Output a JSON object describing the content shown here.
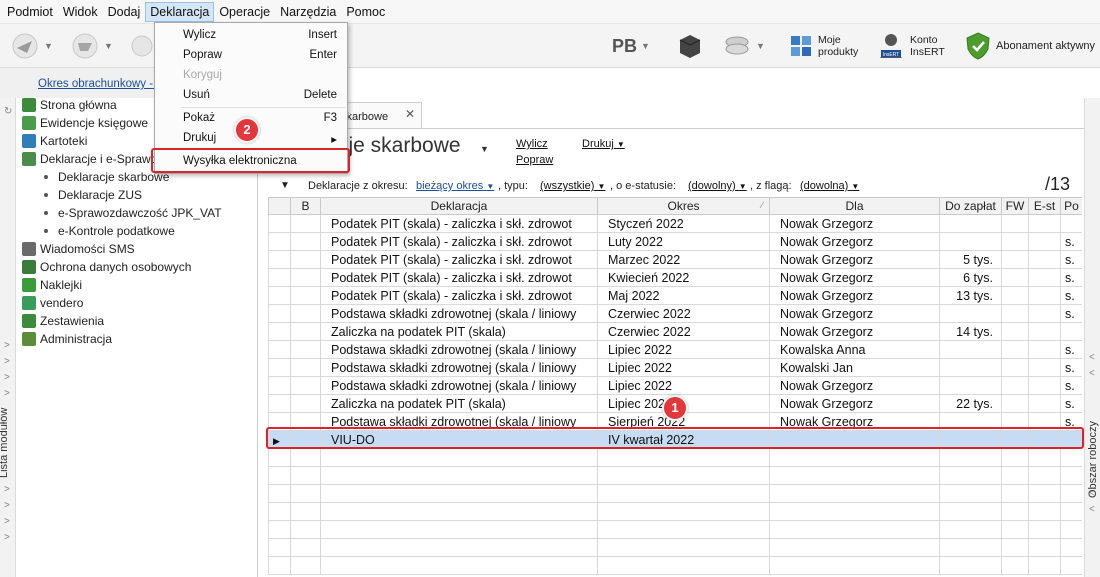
{
  "menu": {
    "items": [
      "Podmiot",
      "Widok",
      "Dodaj",
      "Deklaracja",
      "Operacje",
      "Narzędzia",
      "Pomoc"
    ],
    "active": "Deklaracja"
  },
  "toolbar": {
    "pb_label": "PB",
    "products_label_1": "Moje",
    "products_label_2": "produkty",
    "account_label_1": "Konto",
    "account_label_2": "InsERT",
    "insert_badge": "InsERT",
    "subscription_label": "Abonament aktywny"
  },
  "period": {
    "link": "Okres obrachunkowy - I"
  },
  "dropdown": {
    "items": [
      {
        "label": "Wylicz",
        "key": "Insert",
        "disabled": false
      },
      {
        "label": "Popraw",
        "key": "Enter",
        "disabled": false
      },
      {
        "label": "Koryguj",
        "key": "",
        "disabled": true
      },
      {
        "label": "Usuń",
        "key": "Delete",
        "disabled": false
      },
      {
        "label": "Pokaż",
        "key": "F3",
        "disabled": false
      },
      {
        "label": "Drukuj",
        "key": "▸",
        "disabled": false
      },
      {
        "label": "Wysyłka elektroniczna",
        "key": "",
        "disabled": false
      }
    ]
  },
  "sidebar": {
    "items": [
      {
        "label": "Strona główna",
        "icon": "home-icon",
        "color": "#3a8c3a"
      },
      {
        "label": "Ewidencje księgowe",
        "icon": "ledger-icon",
        "color": "#4a9c4a"
      },
      {
        "label": "Kartoteki",
        "icon": "cards-icon",
        "color": "#2e7fb8"
      },
      {
        "label": "Deklaracje i e-Sprawo",
        "icon": "declarations-icon",
        "color": "#4a8c4a"
      }
    ],
    "subitems": [
      "Deklaracje skarbowe",
      "Deklaracje ZUS",
      "e-Sprawozdawczość JPK_VAT",
      "e-Kontrole podatkowe"
    ],
    "items2": [
      {
        "label": "Wiadomości SMS",
        "icon": "sms-icon",
        "color": "#6a6a6a"
      },
      {
        "label": "Ochrona danych osobowych",
        "icon": "shield-icon",
        "color": "#3a7c3a"
      },
      {
        "label": "Naklejki",
        "icon": "sticker-icon",
        "color": "#3a9c3a"
      },
      {
        "label": "vendero",
        "icon": "vendero-icon",
        "color": "#3a9c5a"
      },
      {
        "label": "Zestawienia",
        "icon": "report-icon",
        "color": "#3a8c3a"
      },
      {
        "label": "Administracja",
        "icon": "admin-icon",
        "color": "#5a8c3a"
      }
    ],
    "strip_label": "Lista modułów"
  },
  "main": {
    "tab_label": "skarbowe",
    "title": "cje skarbowe",
    "actions": {
      "wylicz": "Wylicz",
      "drukuj": "Drukuj",
      "popraw": "Popraw"
    },
    "filters": {
      "prefix": "Deklaracje z okresu:",
      "okres": "bieżący okres",
      "typ_label": ", typu:",
      "typ": "(wszystkie)",
      "status_label": ", o e-statusie:",
      "status": "(dowolny)",
      "flag_label": ", z flagą:",
      "flag": "(dowolna)"
    },
    "count": "/13",
    "columns": [
      "B",
      "Deklaracja",
      "Okres",
      "Dla",
      "Do zapłat",
      "FW",
      "E-st",
      "Po"
    ]
  },
  "rows": [
    {
      "dekl": "Podatek PIT (skala) - zaliczka i skł. zdrowot",
      "okres": "Styczeń 2022",
      "dla": "Nowak Grzegorz",
      "do_zaplaty": "",
      "po": ""
    },
    {
      "dekl": "Podatek PIT (skala) - zaliczka i skł. zdrowot",
      "okres": "Luty 2022",
      "dla": "Nowak Grzegorz",
      "do_zaplaty": "",
      "po": "s."
    },
    {
      "dekl": "Podatek PIT (skala) - zaliczka i skł. zdrowot",
      "okres": "Marzec 2022",
      "dla": "Nowak Grzegorz",
      "do_zaplaty": "5 tys.",
      "po": "s."
    },
    {
      "dekl": "Podatek PIT (skala) - zaliczka i skł. zdrowot",
      "okres": "Kwiecień 2022",
      "dla": "Nowak Grzegorz",
      "do_zaplaty": "6 tys.",
      "po": "s."
    },
    {
      "dekl": "Podatek PIT (skala) - zaliczka i skł. zdrowot",
      "okres": "Maj 2022",
      "dla": "Nowak Grzegorz",
      "do_zaplaty": "13 tys.",
      "po": "s."
    },
    {
      "dekl": "Podstawa składki zdrowotnej (skala / liniowy",
      "okres": "Czerwiec 2022",
      "dla": "Nowak Grzegorz",
      "do_zaplaty": "",
      "po": "s."
    },
    {
      "dekl": "Zaliczka na podatek PIT (skala)",
      "okres": "Czerwiec 2022",
      "dla": "Nowak Grzegorz",
      "do_zaplaty": "14 tys.",
      "po": ""
    },
    {
      "dekl": "Podstawa składki zdrowotnej (skala / liniowy",
      "okres": "Lipiec 2022",
      "dla": "Kowalska Anna",
      "do_zaplaty": "",
      "po": "s."
    },
    {
      "dekl": "Podstawa składki zdrowotnej (skala / liniowy",
      "okres": "Lipiec 2022",
      "dla": "Kowalski Jan",
      "do_zaplaty": "",
      "po": "s."
    },
    {
      "dekl": "Podstawa składki zdrowotnej (skala / liniowy",
      "okres": "Lipiec 2022",
      "dla": "Nowak Grzegorz",
      "do_zaplaty": "",
      "po": "s."
    },
    {
      "dekl": "Zaliczka na podatek PIT (skala)",
      "okres": "Lipiec 2022",
      "dla": "Nowak Grzegorz",
      "do_zaplaty": "22 tys.",
      "po": "s."
    },
    {
      "dekl": "Podstawa składki zdrowotnej (skala / liniowy",
      "okres": "Sierpień 2022",
      "dla": "Nowak Grzegorz",
      "do_zaplaty": "",
      "po": "s."
    },
    {
      "dekl": "VIU-DO",
      "okres": "IV kwartał 2022",
      "dla": "",
      "do_zaplaty": "",
      "po": "",
      "selected": true
    }
  ],
  "badges": {
    "one": "1",
    "two": "2"
  },
  "right_strip_label": "Obszar roboczy",
  "colors": {
    "highlight_red": "#d9252a",
    "selection": "#c5dcf2",
    "link_blue": "#1a4fa0"
  }
}
